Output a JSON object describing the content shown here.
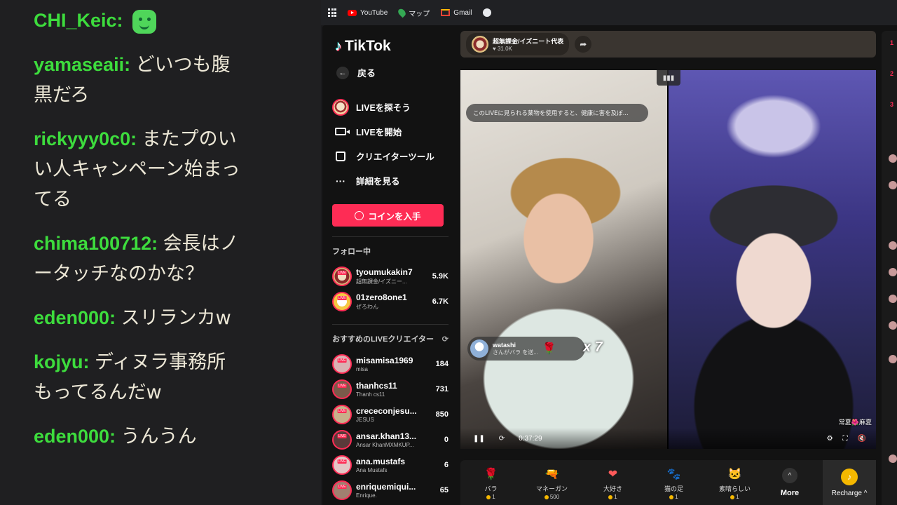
{
  "chat": {
    "messages": [
      {
        "user": "CHI_Keic",
        "text": ""
      },
      {
        "user": "yamaseaii",
        "text": "どいつも腹黒だろ"
      },
      {
        "user": "rickyyy0c0",
        "text": "またプのいい人キャンペーン始まってる"
      },
      {
        "user": "chima100712",
        "text": "会長はノータッチなのかな？"
      },
      {
        "user": "eden000",
        "text": "スリランカw"
      },
      {
        "user": "kojyu",
        "text": "ディヌラ事務所もってるんだw"
      },
      {
        "user": "eden000",
        "text": "うんうん"
      }
    ],
    "separator": ": ",
    "emote_icon": "green-smile-emote"
  },
  "bookmarks": {
    "items": [
      {
        "label": "YouTube",
        "icon": "youtube-icon"
      },
      {
        "label": "マップ",
        "icon": "maps-icon"
      },
      {
        "label": "Gmail",
        "icon": "gmail-icon"
      }
    ]
  },
  "tiktok": {
    "brand": "TikTok",
    "back_label": "戻る",
    "nav": [
      {
        "label": "LIVEを探そう",
        "icon": "live-avatar-icon"
      },
      {
        "label": "LIVEを開始",
        "icon": "camera-icon"
      },
      {
        "label": "クリエイターツール",
        "icon": "creator-tools-icon"
      },
      {
        "label": "詳細を見る",
        "icon": "more-dots-icon"
      }
    ],
    "coin_button": "コインを入手",
    "following_title": "フォロー中",
    "following": [
      {
        "name": "tyoumukakin7",
        "sub": "超無課金/イズニー...",
        "count": "5.9K"
      },
      {
        "name": "01zero8one1",
        "sub": "ぜろわん",
        "count": "6.7K"
      }
    ],
    "recommended_title": "おすすめのLIVEクリエイター",
    "recommended": [
      {
        "name": "misamisa1969",
        "sub": "misa",
        "count": "184"
      },
      {
        "name": "thanhcs11",
        "sub": "Thanh cs11",
        "count": "731"
      },
      {
        "name": "crececonjesu...",
        "sub": "JESUS",
        "count": "850"
      },
      {
        "name": "ansar.khan13...",
        "sub": "Ansar KhanMXMKUP...",
        "count": "0"
      },
      {
        "name": "ana.mustafs",
        "sub": "Ana Mustafs",
        "count": "6"
      },
      {
        "name": "enriquemiqui...",
        "sub": "Enrique.",
        "count": "65"
      }
    ],
    "host": {
      "name": "超無課金/イズニート代表",
      "likes": "31.0K"
    },
    "video": {
      "warning": "このLIVEに見られる薬物を使用すると、健康に害を及ぼ...",
      "toast_user": "watashi",
      "toast_text": "さんがバラ を送...",
      "combo": "x 7",
      "time": "0:37:29",
      "watermark": "常夏🌺麻夏"
    },
    "gifts": [
      {
        "name": "バラ",
        "price": "1",
        "icon": "rose-icon",
        "color": "#ff2d55",
        "glyph": "🌹"
      },
      {
        "name": "マネーガン",
        "price": "500",
        "icon": "money-gun-icon",
        "color": "#ff8fd6",
        "glyph": "🔫"
      },
      {
        "name": "大好き",
        "price": "1",
        "icon": "heart-love-icon",
        "color": "#ff5a5a",
        "glyph": "❤"
      },
      {
        "name": "猫の足",
        "price": "1",
        "icon": "cat-paw-icon",
        "color": "#f1d1c1",
        "glyph": "🐾"
      },
      {
        "name": "素晴らしい",
        "price": "1",
        "icon": "cat-awesome-icon",
        "color": "#d9b38c",
        "glyph": "🐱"
      }
    ],
    "more_label": "More",
    "recharge_label": "Recharge ^",
    "right_ranks": [
      "1",
      "2",
      "3"
    ]
  }
}
